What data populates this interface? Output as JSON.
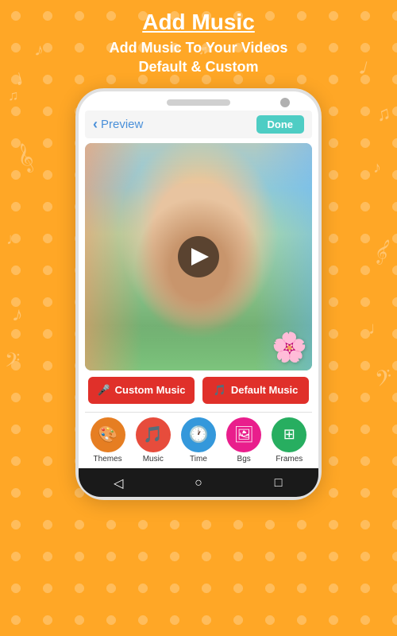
{
  "page": {
    "title": "Add Music",
    "subtitle": "Add Music To Your Videos\nDefault & Custom",
    "background_color": "#FFA726"
  },
  "header": {
    "back_label": "Preview",
    "done_label": "Done"
  },
  "music_buttons": {
    "custom_label": "Custom Music",
    "default_label": "Default Music"
  },
  "bottom_nav": {
    "items": [
      {
        "id": "themes",
        "label": "Themes",
        "icon": "🎨",
        "color": "#E67E22"
      },
      {
        "id": "music",
        "label": "Music",
        "icon": "🎵",
        "color": "#E74C3C"
      },
      {
        "id": "time",
        "label": "Time",
        "icon": "🕐",
        "color": "#3498DB"
      },
      {
        "id": "bgs",
        "label": "Bgs",
        "icon": "🖼",
        "color": "#E91E8C"
      },
      {
        "id": "frames",
        "label": "Frames",
        "icon": "⊞",
        "color": "#27AE60"
      }
    ]
  },
  "phone_nav": {
    "back_icon": "◁",
    "home_icon": "○",
    "recent_icon": "□"
  }
}
